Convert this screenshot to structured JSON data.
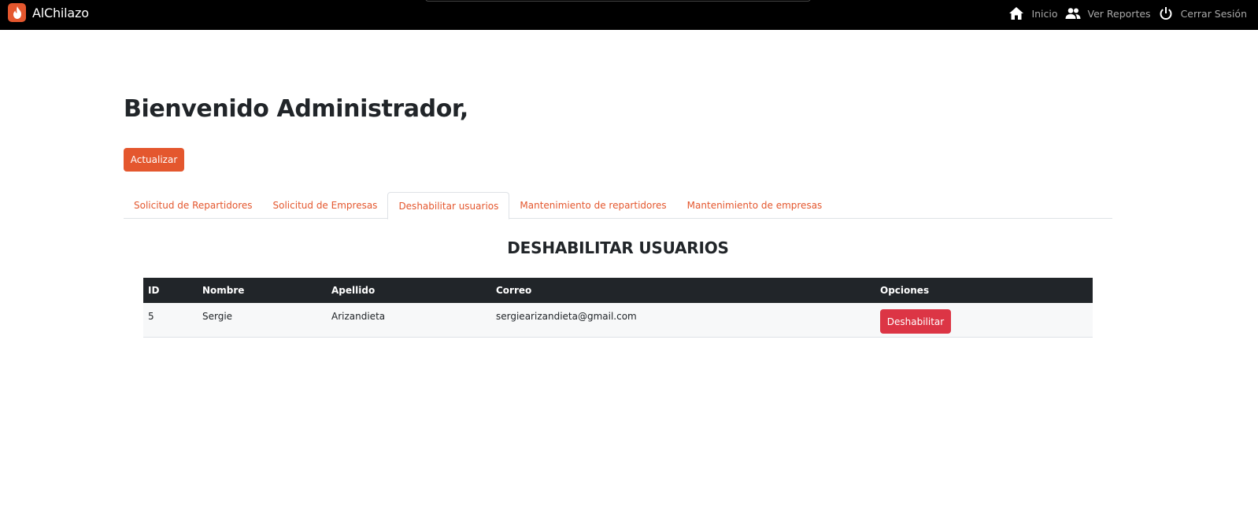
{
  "navbar": {
    "brand": "AlChilazo",
    "links": [
      {
        "label": "Inicio",
        "icon": "home-icon"
      },
      {
        "label": "Ver Reportes",
        "icon": "users-icon"
      },
      {
        "label": "Cerrar Sesión",
        "icon": "power-icon"
      }
    ]
  },
  "page": {
    "title": "Bienvenido Administrador,",
    "refresh_label": "Actualizar"
  },
  "tabs": [
    {
      "label": "Solicitud de Repartidores",
      "active": false
    },
    {
      "label": "Solicitud de Empresas",
      "active": false
    },
    {
      "label": "Deshabilitar usuarios",
      "active": true
    },
    {
      "label": "Mantenimiento de repartidores",
      "active": false
    },
    {
      "label": "Mantenimiento de empresas",
      "active": false
    }
  ],
  "section": {
    "title": "DESHABILITAR USUARIOS"
  },
  "table": {
    "headers": [
      "ID",
      "Nombre",
      "Apellido",
      "Correo",
      "Opciones"
    ],
    "rows": [
      {
        "id": "5",
        "nombre": "Sergie",
        "apellido": "Arizandieta",
        "correo": "sergiearizandieta@gmail.com",
        "action": "Deshabilitar"
      }
    ]
  },
  "colors": {
    "accent": "#e4572e",
    "danger": "#dc3545",
    "navbar_bg": "#000000",
    "table_header_bg": "#212529"
  }
}
